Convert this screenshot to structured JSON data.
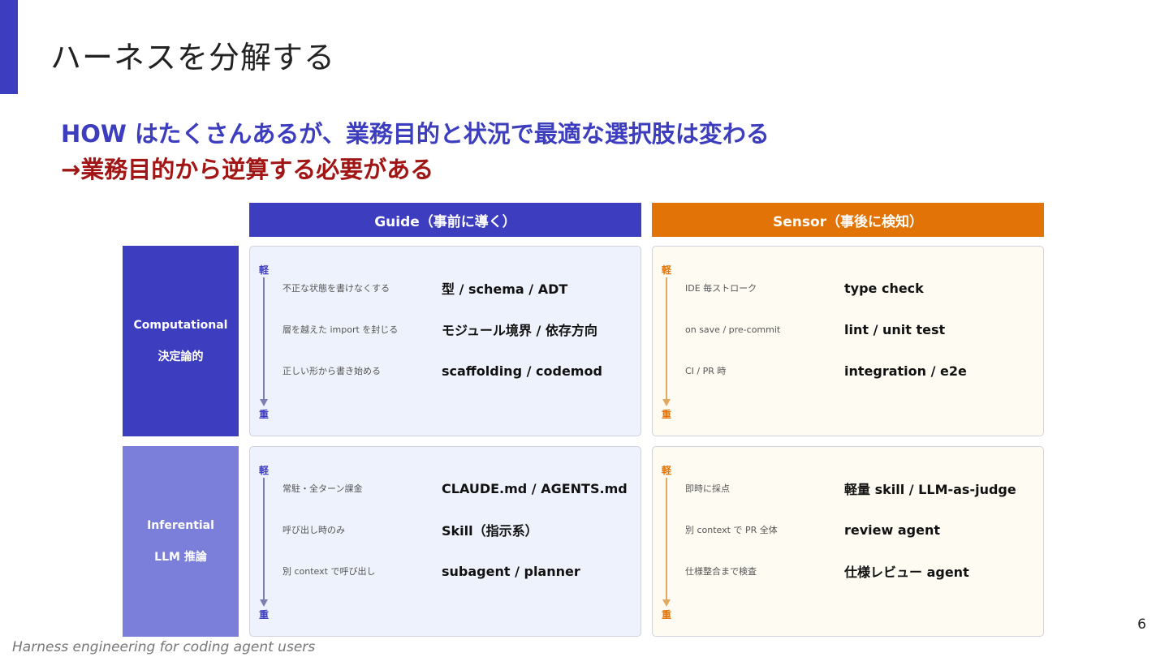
{
  "title": "ハーネスを分解する",
  "message": {
    "line1": "HOW はたくさんあるが、業務目的と状況で最適な選択肢は変わる",
    "line2": "→業務目的から逆算する必要がある"
  },
  "columns": {
    "guide": "Guide（事前に導く）",
    "sensor": "Sensor（事後に検知）"
  },
  "rows": {
    "computational": {
      "label": "Computational",
      "sub": "決定論的"
    },
    "inferential": {
      "label": "Inferential",
      "sub": "LLM 推論"
    }
  },
  "scale": {
    "light": "軽",
    "heavy": "重"
  },
  "cells": {
    "guide_computational": [
      {
        "desc": "不正な状態を書けなくする",
        "tech": "型 / schema / ADT"
      },
      {
        "desc": "層を越えた import を封じる",
        "tech": "モジュール境界 / 依存方向"
      },
      {
        "desc": "正しい形から書き始める",
        "tech": "scaffolding / codemod"
      }
    ],
    "sensor_computational": [
      {
        "desc": "IDE 毎ストローク",
        "tech": "type check"
      },
      {
        "desc": "on save / pre-commit",
        "tech": "lint / unit test"
      },
      {
        "desc": "CI / PR 時",
        "tech": "integration / e2e"
      }
    ],
    "guide_inferential": [
      {
        "desc": "常駐・全ターン課金",
        "tech": "CLAUDE.md / AGENTS.md"
      },
      {
        "desc": "呼び出し時のみ",
        "tech": "Skill（指示系）"
      },
      {
        "desc": "別 context で呼び出し",
        "tech": "subagent / planner"
      }
    ],
    "sensor_inferential": [
      {
        "desc": "即時に採点",
        "tech": "軽量 skill / LLM-as-judge"
      },
      {
        "desc": "別 context で PR 全体",
        "tech": "review agent"
      },
      {
        "desc": "仕様整合まで検査",
        "tech": "仕様レビュー agent"
      }
    ]
  },
  "page_number": "6",
  "footer": "Harness engineering for coding agent users",
  "colors": {
    "guide": "#3d3dbf",
    "sensor": "#e27407",
    "inferential": "#7b7fd9",
    "emphasis": "#a11515"
  }
}
